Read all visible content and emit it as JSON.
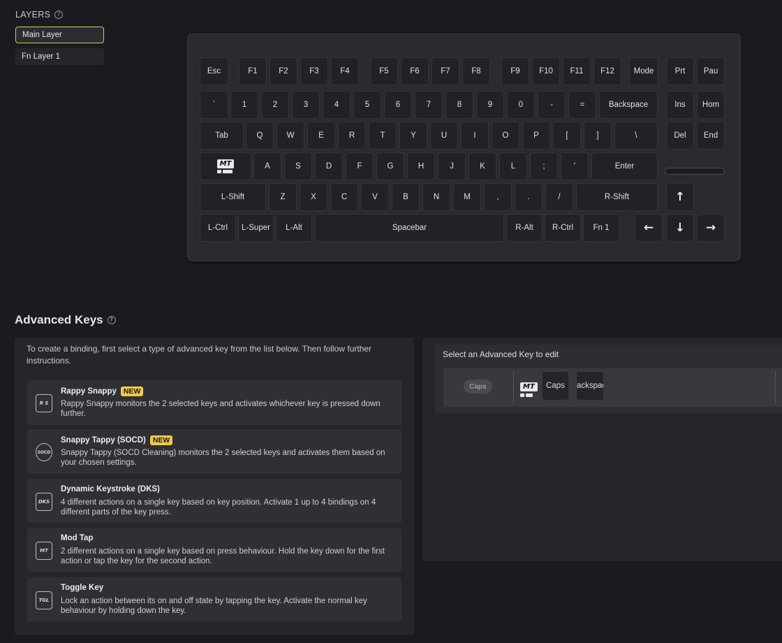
{
  "layers": {
    "title": "LAYERS",
    "help": "?",
    "items": [
      {
        "label": "Main Layer",
        "active": true
      },
      {
        "label": "Fn Layer 1",
        "active": false
      }
    ]
  },
  "keyboard": {
    "rows": [
      [
        "Esc",
        "F1",
        "F2",
        "F3",
        "F4",
        "F5",
        "F6",
        "F7",
        "F8",
        "F9",
        "F10",
        "F11",
        "F12",
        "Mode",
        "Prt",
        "Pau"
      ],
      [
        "`",
        "1",
        "2",
        "3",
        "4",
        "5",
        "6",
        "7",
        "8",
        "9",
        "0",
        "-",
        "=",
        "Backspace",
        "Ins",
        "Hom"
      ],
      [
        "Tab",
        "Q",
        "W",
        "E",
        "R",
        "T",
        "Y",
        "U",
        "I",
        "O",
        "P",
        "[",
        "]",
        "\\",
        "Del",
        "End"
      ],
      [
        "MT",
        "A",
        "S",
        "D",
        "F",
        "G",
        "H",
        "J",
        "K",
        "L",
        ";",
        "'",
        "Enter"
      ],
      [
        "L-Shift",
        "Z",
        "X",
        "C",
        "V",
        "B",
        "N",
        "M",
        ",",
        ".",
        "/",
        "R-Shift",
        "↑"
      ],
      [
        "L-Ctrl",
        "L-Super",
        "L-Alt",
        "Spacebar",
        "R-Alt",
        "R-Ctrl",
        "Fn 1",
        "←",
        "↓",
        "→"
      ]
    ]
  },
  "advanced": {
    "title": "Advanced Keys",
    "help": "?",
    "intro": "To create a binding, first select a type of advanced key from the list below. Then follow further instructions.",
    "cards": [
      {
        "icon": "R S",
        "title": "Rappy Snappy",
        "badge": "NEW",
        "desc": "Rappy Snappy monitors the 2 selected keys and activates whichever key is pressed down further."
      },
      {
        "icon": "SOCD",
        "title": "Snappy Tappy (SOCD)",
        "badge": "NEW",
        "desc": "Snappy Tappy (SOCD Cleaning) monitors the 2 selected keys and activates them based on your chosen settings."
      },
      {
        "icon": "DKS",
        "title": "Dynamic Keystroke (DKS)",
        "badge": "",
        "desc": "4 different actions on a single key based on key position. Activate 1 up to 4 bindings on 4 different parts of the key press."
      },
      {
        "icon": "MT",
        "title": "Mod Tap",
        "badge": "",
        "desc": "2 different actions on a single key based on press behaviour. Hold the key down for the first action or tap the key for the second action."
      },
      {
        "icon": "TGL",
        "title": "Toggle Key",
        "badge": "",
        "desc": "Lock an action between its on and off state by tapping the key. Activate the normal key behaviour by holding down the key."
      }
    ]
  },
  "editor": {
    "title": "Select an Advanced Key to edit",
    "pill": "Caps",
    "icon": "MT",
    "keys": [
      "Caps",
      "ackspac"
    ]
  },
  "colors": {
    "accent": "#e9c25a",
    "badge": "#f2c94c"
  }
}
